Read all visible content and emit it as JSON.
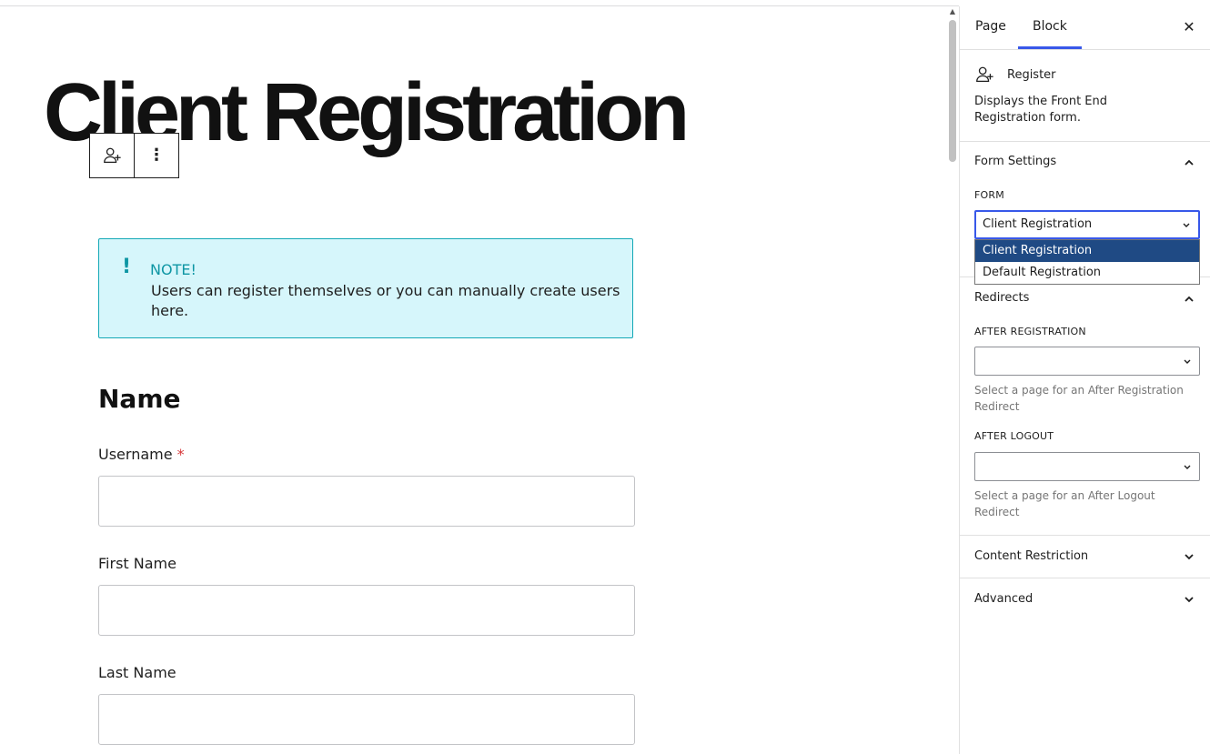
{
  "editor": {
    "title": "Client Registration",
    "toolbar": {
      "block_icon": "user-plus-icon",
      "options_icon": "more-vertical-icon",
      "options_glyph": "⋮"
    },
    "notice": {
      "mark": "!",
      "title": "NOTE!",
      "body": "Users can register themselves or you can manually create users here."
    },
    "section_heading": "Name",
    "fields": [
      {
        "label": "Username",
        "required": true,
        "required_mark": "*"
      },
      {
        "label": "First Name",
        "required": false
      },
      {
        "label": "Last Name",
        "required": false
      }
    ]
  },
  "sidebar": {
    "tabs": [
      {
        "label": "Page",
        "active": false
      },
      {
        "label": "Block",
        "active": true
      }
    ],
    "close_glyph": "✕",
    "block_card": {
      "icon": "user-plus-icon",
      "name": "Register",
      "description": "Displays the Front End Registration form."
    },
    "form_settings": {
      "title": "Form Settings",
      "expanded": true,
      "form_label": "FORM",
      "form_value": "Client Registration",
      "options": [
        "Client Registration",
        "Default Registration"
      ],
      "selected_index": 0
    },
    "redirects": {
      "title": "Redirects",
      "expanded": true,
      "after_registration": {
        "label": "AFTER REGISTRATION",
        "value": "",
        "help": "Select a page for an After Registration Redirect"
      },
      "after_logout": {
        "label": "AFTER LOGOUT",
        "value": "",
        "help": "Select a page for an After Logout Redirect"
      }
    },
    "content_restriction": {
      "title": "Content Restriction",
      "expanded": false
    },
    "advanced": {
      "title": "Advanced",
      "expanded": false
    }
  },
  "colors": {
    "accent": "#3858e9",
    "notice_border": "#13a8b6",
    "notice_bg": "#d6f6fb",
    "notice_text": "#0e96a4",
    "required": "#d63638",
    "dropdown_selected": "#1f4a84"
  }
}
